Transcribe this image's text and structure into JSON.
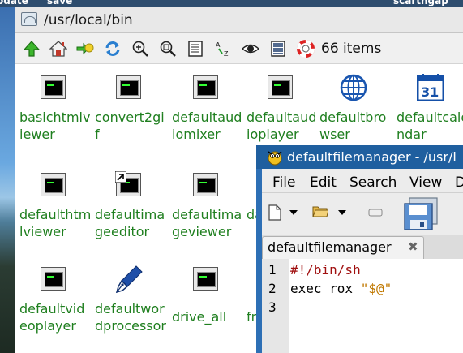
{
  "desktop": {
    "top_items": [
      "odate",
      "save",
      "scarthgap"
    ]
  },
  "rox": {
    "title": "/usr/local/bin",
    "items_count": "66 items",
    "toolbar_icons": [
      "up-icon",
      "home-icon",
      "bookmarks-icon",
      "refresh-icon",
      "zoom-in-icon",
      "zoom-fit-icon",
      "details-icon",
      "sort-icon",
      "show-hidden-icon",
      "select-icon",
      "help-icon"
    ],
    "files": [
      {
        "label": "basichtmlviewer",
        "icon": "terminal-icon"
      },
      {
        "label": "convert2gif",
        "icon": "terminal-icon"
      },
      {
        "label": "defaultaudiomixer",
        "icon": "terminal-icon"
      },
      {
        "label": "defaultaudioplayer",
        "icon": "terminal-icon"
      },
      {
        "label": "defaultbrowser",
        "icon": "globe-icon"
      },
      {
        "label": "defaultcalendar",
        "icon": "calendar-icon"
      },
      {
        "label": "defaulthtmlviewer",
        "icon": "terminal-icon"
      },
      {
        "label": "defaultimageeditor",
        "icon": "terminal-link-icon"
      },
      {
        "label": "defaultimageviewer",
        "icon": "terminal-icon"
      },
      {
        "label": "da",
        "icon": "terminal-icon"
      },
      {
        "label": "defaultvideoplayer",
        "icon": "terminal-icon"
      },
      {
        "label": "defaultwordprocessor",
        "icon": "pen-nib-icon"
      },
      {
        "label": "drive_all",
        "icon": "terminal-icon"
      },
      {
        "label": "frel",
        "icon": "terminal-icon"
      }
    ]
  },
  "editor": {
    "title": "defaultfilemanager - /usr/l",
    "menu": [
      "File",
      "Edit",
      "Search",
      "View",
      "D"
    ],
    "tab": {
      "label": "defaultfilemanager",
      "close": "✖"
    },
    "lines": [
      {
        "num": "1",
        "text": "#!/bin/sh"
      },
      {
        "num": "2",
        "cmd": "exec rox ",
        "str": "\"$@\""
      },
      {
        "num": "3",
        "text": ""
      }
    ]
  },
  "colors": {
    "label": "#1f7f1f",
    "editor_frame": "#2d6fb5",
    "shebang": "#a01010",
    "string": "#c07800"
  }
}
